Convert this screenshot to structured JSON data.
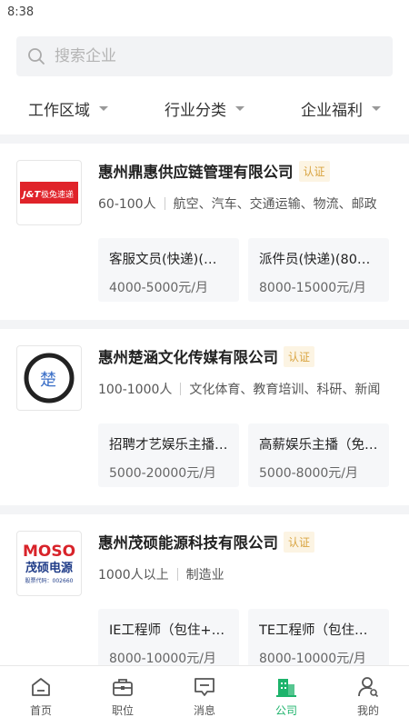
{
  "status_bar": {
    "time": "8:38"
  },
  "search": {
    "placeholder": "搜索企业"
  },
  "filters": [
    {
      "label": "工作区域"
    },
    {
      "label": "行业分类"
    },
    {
      "label": "企业福利"
    }
  ],
  "companies": [
    {
      "name": "惠州鼎惠供应链管理有限公司",
      "badge": "认证",
      "size": "60-100人",
      "industry": "航空、汽车、交通运输、物流、邮政",
      "logo_text": "J&T极兔速递",
      "jobs": [
        {
          "title": "客服文员(快递)(…",
          "salary": "4000-5000元/月"
        },
        {
          "title": "派件员(快递)(80…",
          "salary": "8000-15000元/月"
        }
      ]
    },
    {
      "name": "惠州楚涵文化传媒有限公司",
      "badge": "认证",
      "size": "100-1000人",
      "industry": "文化体育、教育培训、科研、新闻",
      "logo_text": "楚",
      "jobs": [
        {
          "title": "招聘才艺娱乐主播…",
          "salary": "5000-20000元/月"
        },
        {
          "title": "高薪娱乐主播（免…",
          "salary": "5000-8000元/月"
        }
      ]
    },
    {
      "name": "惠州茂硕能源科技有限公司",
      "badge": "认证",
      "size": "1000人以上",
      "industry": "制造业",
      "logo_text": "MOSO",
      "logo_subtext": "茂硕电源",
      "logo_code": "股票代码：002660",
      "jobs": [
        {
          "title": "IE工程师（包住+…",
          "salary": "8000-10000元/月"
        },
        {
          "title": "TE工程师（包住+…",
          "salary": "8000-10000元/月"
        }
      ]
    }
  ],
  "tabbar": [
    {
      "label": "首页",
      "icon": "home-icon"
    },
    {
      "label": "职位",
      "icon": "briefcase-icon"
    },
    {
      "label": "消息",
      "icon": "message-icon"
    },
    {
      "label": "公司",
      "icon": "company-icon",
      "active": true
    },
    {
      "label": "我的",
      "icon": "profile-icon"
    }
  ],
  "colors": {
    "accent": "#1db36b",
    "badge_text": "#d9a441",
    "badge_bg": "#fcf4e3"
  }
}
